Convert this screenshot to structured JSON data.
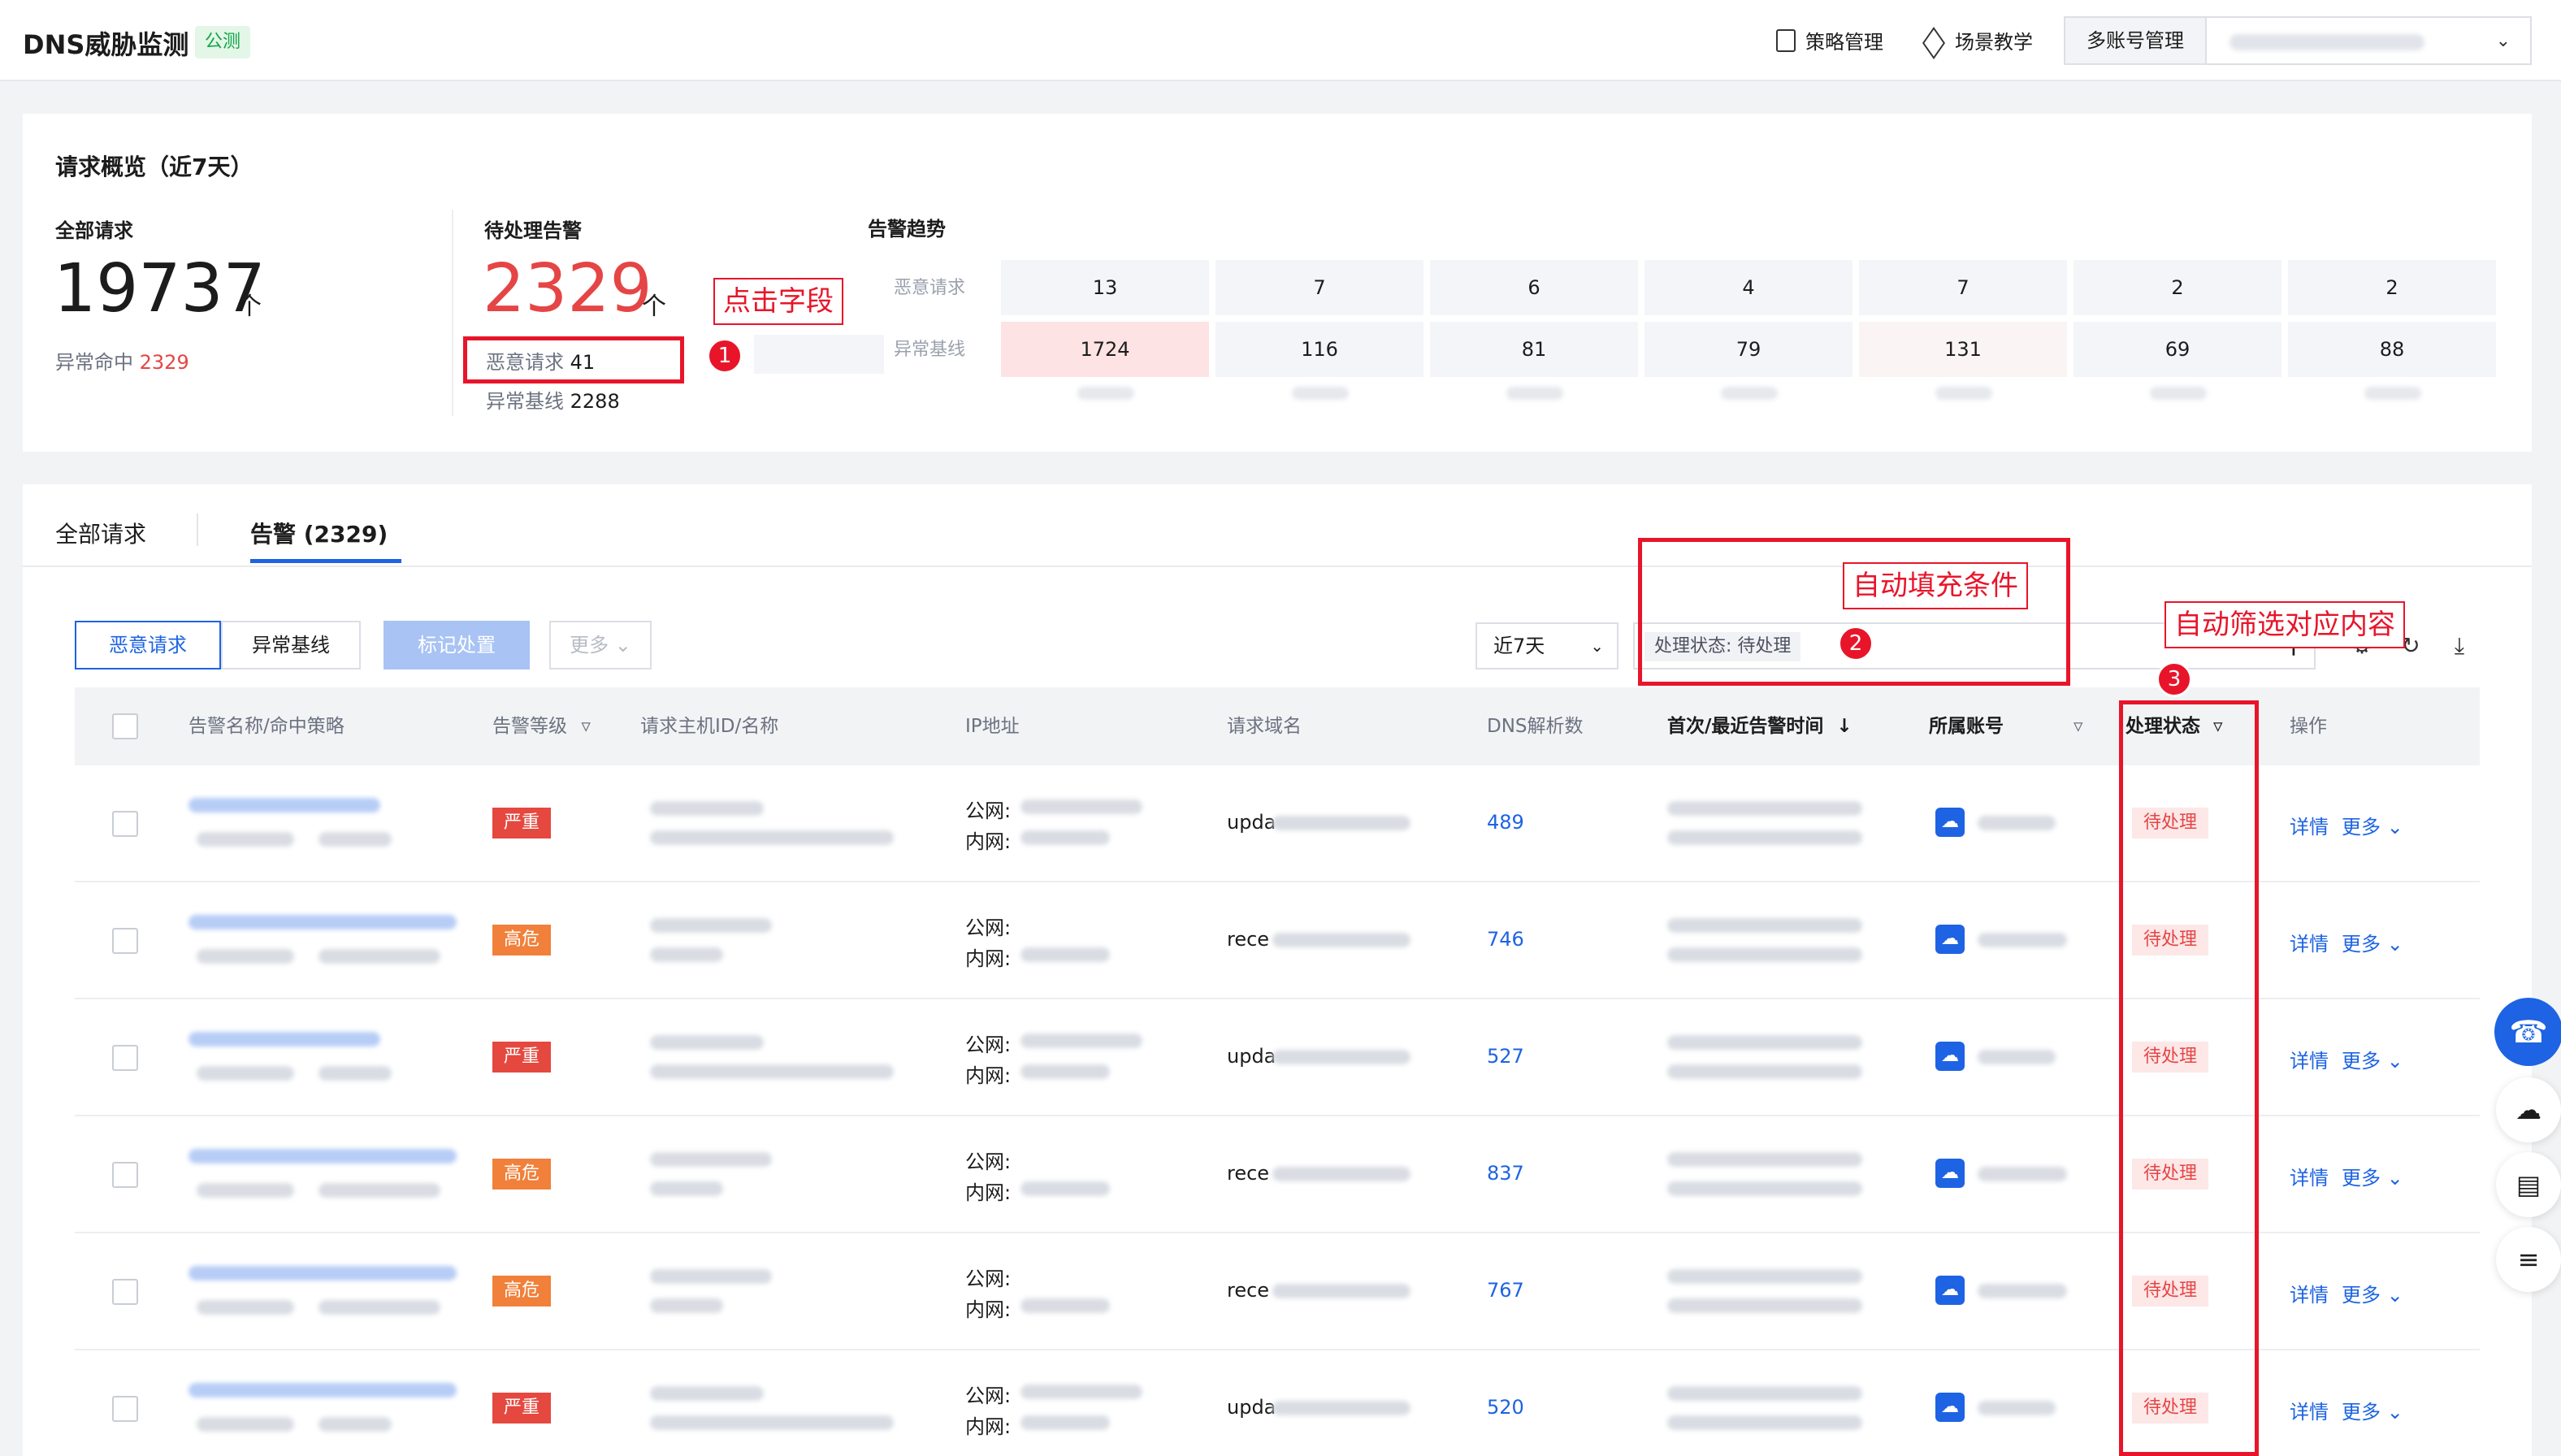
{
  "header": {
    "title": "DNS威胁监测",
    "beta_tag": "公测",
    "links": [
      "策略管理",
      "场景教学"
    ],
    "multi_account_label": "多账号管理"
  },
  "overview": {
    "title": "请求概览（近7天）",
    "total": {
      "label": "全部请求",
      "value": "19737",
      "unit": "个",
      "sub_label": "异常命中",
      "sub_value": "2329"
    },
    "pending": {
      "label": "待处理告警",
      "value": "2329",
      "unit": "个",
      "malicious_label": "恶意请求",
      "malicious_value": "41",
      "baseline_label": "异常基线",
      "baseline_value": "2288"
    },
    "trend": {
      "label": "告警趋势",
      "rows": [
        {
          "name": "恶意请求",
          "values": [
            "13",
            "7",
            "6",
            "4",
            "7",
            "2",
            "2"
          ]
        },
        {
          "name": "异常基线",
          "values": [
            "1724",
            "116",
            "81",
            "79",
            "131",
            "69",
            "88"
          ]
        }
      ]
    }
  },
  "annotations": {
    "a1": "点击字段",
    "a1_num": "1",
    "a2": "自动填充条件",
    "a2_num": "2",
    "a3": "自动筛选对应内容",
    "a3_num": "3"
  },
  "tabs": [
    {
      "label": "全部请求"
    },
    {
      "label": "告警 (2329)"
    }
  ],
  "toolbar": {
    "btn_malicious": "恶意请求",
    "btn_baseline": "异常基线",
    "btn_mark": "标记处置",
    "btn_more": "更多",
    "range": "近7天",
    "filter_chip": "处理状态: 待处理"
  },
  "table": {
    "headers": {
      "name": "告警名称/命中策略",
      "level": "告警等级",
      "host": "请求主机ID/名称",
      "ip": "IP地址",
      "domain": "请求域名",
      "dns": "DNS解析数",
      "time": "首次/最近告警时间",
      "account": "所属账号",
      "status": "处理状态",
      "ops": "操作"
    },
    "ip_public": "公网:",
    "ip_private": "内网:",
    "rows": [
      {
        "level": "严重",
        "domain": "upda",
        "dns": "489",
        "status": "待处理",
        "detail": "详情",
        "more": "更多"
      },
      {
        "level": "高危",
        "domain": "rece",
        "dns": "746",
        "status": "待处理",
        "detail": "详情",
        "more": "更多"
      },
      {
        "level": "严重",
        "domain": "upda",
        "dns": "527",
        "status": "待处理",
        "detail": "详情",
        "more": "更多"
      },
      {
        "level": "高危",
        "domain": "rece",
        "dns": "837",
        "status": "待处理",
        "detail": "详情",
        "more": "更多"
      },
      {
        "level": "高危",
        "domain": "rece",
        "dns": "767",
        "status": "待处理",
        "detail": "详情",
        "more": "更多"
      },
      {
        "level": "严重",
        "domain": "upda",
        "dns": "520",
        "status": "待处理",
        "detail": "详情",
        "more": "更多"
      }
    ]
  },
  "colors": {
    "accent": "#1d63e3",
    "annotation_red": "#e8152a",
    "severe": "#e5483f",
    "high": "#f0803a"
  },
  "icons": [
    "policy-icon",
    "tutorial-icon",
    "chevron-down-icon",
    "search-icon",
    "settings-icon",
    "refresh-icon",
    "download-icon",
    "filter-icon",
    "sort-down-icon",
    "cloud-icon",
    "support-icon",
    "book-icon",
    "list-icon"
  ]
}
